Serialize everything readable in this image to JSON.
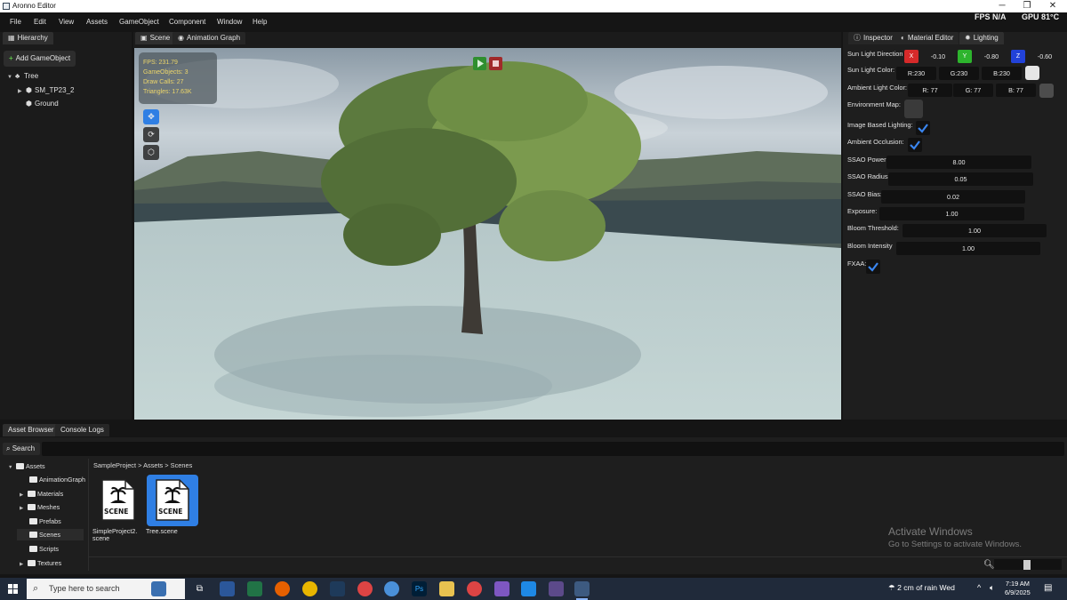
{
  "window": {
    "title": "Aronno Editor",
    "minimize": "─",
    "maximize": "❐",
    "close": "✕"
  },
  "menu": [
    "File",
    "Edit",
    "View",
    "Assets",
    "GameObject",
    "Component",
    "Window",
    "Help"
  ],
  "perf": {
    "fps": "FPS N/A",
    "gpu": "GPU 81°C"
  },
  "hierarchy": {
    "tab": "Hierarchy",
    "add_button": "Add GameObject",
    "nodes": [
      "Tree",
      "SM_TP23_2",
      "Ground"
    ]
  },
  "center_tabs": [
    "Scene",
    "Animation Graph"
  ],
  "stats": [
    "FPS: 231.79",
    "GameObjects: 3",
    "Draw Calls: 27",
    "Triangles: 17.63K"
  ],
  "inspector": {
    "tabs": [
      "Inspector",
      "Material Editor",
      "Lighting"
    ],
    "sun_direction": {
      "label": "Sun Light Direction",
      "x_label": "X",
      "x": "-0.10",
      "y_label": "Y",
      "y": "-0.80",
      "z_label": "Z",
      "z": "-0.60"
    },
    "sun_color": {
      "label": "Sun Light Color:",
      "r": "R:230",
      "g": "G:230",
      "b": "B:230",
      "swatch": "#e6e6e6"
    },
    "ambient_color": {
      "label": "Ambient Light Color:",
      "r": "R: 77",
      "g": "G: 77",
      "b": "B: 77",
      "swatch": "#4d4d4d"
    },
    "environment_map": {
      "label": "Environment Map:"
    },
    "ibl": {
      "label": "Image Based Lighting:",
      "checked": true
    },
    "ao": {
      "label": "Ambient Occlusion:",
      "checked": true
    },
    "ssao_power": {
      "label": "SSAO Power:",
      "value": "8.00"
    },
    "ssao_radius": {
      "label": "SSAO Radius:",
      "value": "0.05"
    },
    "ssao_bias": {
      "label": "SSAO Bias:",
      "value": "0.02"
    },
    "exposure": {
      "label": "Exposure:",
      "value": "1.00"
    },
    "bloom_threshold": {
      "label": "Bloom Threshold:",
      "value": "1.00"
    },
    "bloom_intensity": {
      "label": "Bloom Intensity",
      "value": "1.00"
    },
    "fxaa": {
      "label": "FXAA:",
      "checked": true
    }
  },
  "bottom_tabs": [
    "Asset Browser",
    "Console Logs"
  ],
  "assets": {
    "search_label": "Search",
    "search_value": "",
    "folders": [
      "Assets",
      "AnimationGraph",
      "Materials",
      "Meshes",
      "Prefabs",
      "Scenes",
      "Scripts",
      "Textures"
    ],
    "breadcrumb": "SampleProject > Assets > Scenes",
    "files": [
      {
        "line1": "SimpleProject2.",
        "line2": "scene",
        "badge": "SCENE"
      },
      {
        "line1": "Tree.scene",
        "line2": "",
        "badge": "SCENE"
      }
    ]
  },
  "watermark": {
    "line1": "Activate Windows",
    "line2": "Go to Settings to activate Windows."
  },
  "taskbar": {
    "search_placeholder": "Type here to search",
    "weather": "2 cm of rain Wed",
    "time": "7:19 AM",
    "date": "6/9/2025"
  },
  "colors": {
    "accent": "#2f7fe4",
    "axis_x": "#d62a2a",
    "axis_y": "#2db42d",
    "axis_z": "#2242d8",
    "stats_text": "#ecd56a"
  }
}
